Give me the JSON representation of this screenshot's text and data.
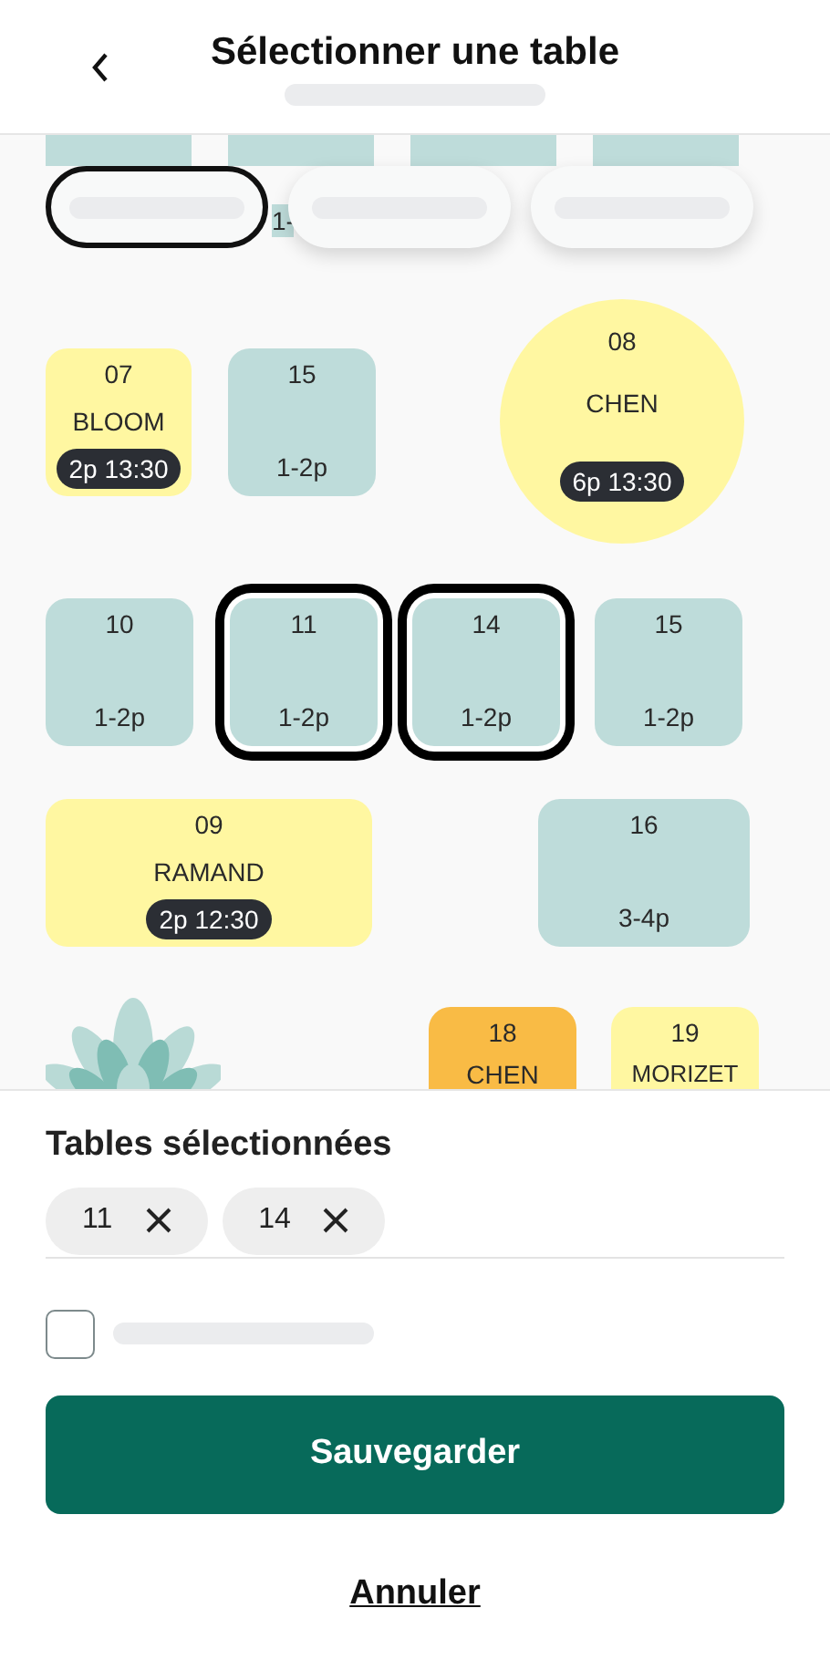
{
  "header": {
    "title": "Sélectionner une table"
  },
  "filters": [
    {
      "selected": true
    },
    {
      "selected": false
    },
    {
      "selected": false
    }
  ],
  "tables": [
    {
      "kind": "cut",
      "color": "#bedcda"
    },
    {
      "kind": "cut",
      "color": "#bedcda",
      "capacity": "1-"
    },
    {
      "kind": "cut",
      "color": "#bedcda"
    },
    {
      "kind": "cut",
      "color": "#bedcda"
    },
    {
      "kind": "rect",
      "color": "#fff7a1",
      "selected": false,
      "number": "07",
      "name": "BLOOM",
      "booking": "2p 13:30"
    },
    {
      "kind": "rect",
      "color": "#bedcda",
      "selected": false,
      "number": "15",
      "capacity": "1-2p"
    },
    {
      "kind": "round",
      "color": "#fff7a1",
      "selected": false,
      "number": "08",
      "name": "CHEN",
      "booking": "6p 13:30"
    },
    {
      "kind": "rect",
      "color": "#bedcda",
      "selected": false,
      "number": "10",
      "capacity": "1-2p"
    },
    {
      "kind": "rect",
      "color": "#bedcda",
      "selected": true,
      "number": "11",
      "capacity": "1-2p"
    },
    {
      "kind": "rect",
      "color": "#bedcda",
      "selected": true,
      "number": "14",
      "capacity": "1-2p"
    },
    {
      "kind": "rect",
      "color": "#bedcda",
      "selected": false,
      "number": "15",
      "capacity": "1-2p"
    },
    {
      "kind": "rect",
      "color": "#fff7a1",
      "selected": false,
      "number": "09",
      "name": "RAMAND",
      "booking": "2p 12:30"
    },
    {
      "kind": "rect",
      "color": "#bedcda",
      "selected": false,
      "number": "16",
      "capacity": "3-4p"
    },
    {
      "kind": "rect",
      "color": "#f9bb45",
      "selected": false,
      "number": "18",
      "name": "CHEN"
    },
    {
      "kind": "rect",
      "color": "#fff7a1",
      "selected": false,
      "number": "19",
      "name": "MORIZET"
    }
  ],
  "selection": {
    "title": "Tables sélectionnées",
    "chips": [
      {
        "label": "11"
      },
      {
        "label": "14"
      }
    ]
  },
  "option": {
    "checked": false
  },
  "save_button": "Sauvegarder",
  "cancel_link": "Annuler"
}
